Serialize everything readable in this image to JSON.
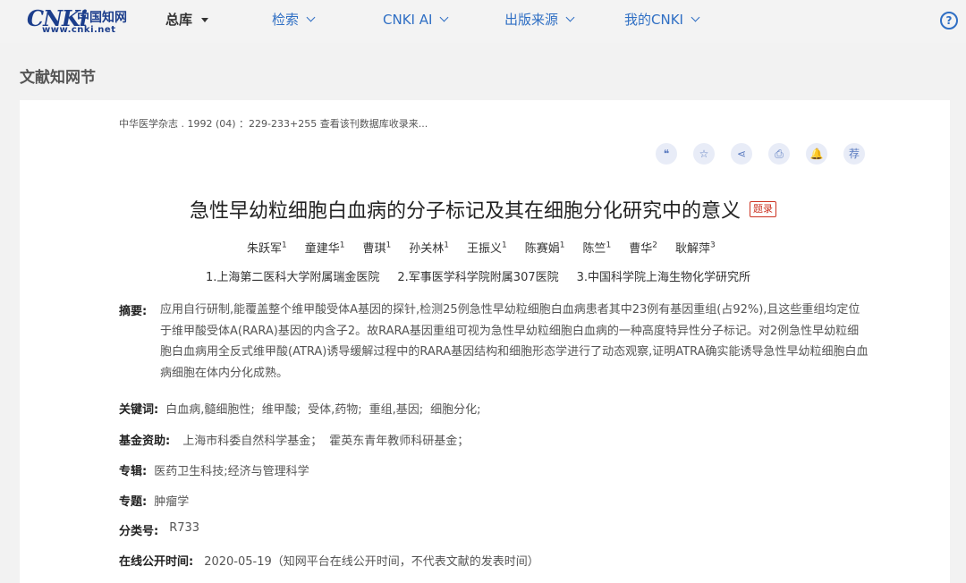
{
  "nav": {
    "logo_text": "CNKi",
    "logo_cn": "中国知网",
    "logo_url": "www.cnki.net",
    "items": [
      {
        "label": "总库"
      },
      {
        "label": "检索"
      },
      {
        "label": "CNKI AI"
      },
      {
        "label": "出版来源"
      },
      {
        "label": "我的CNKI"
      }
    ],
    "help_label": "?"
  },
  "section_title": "文献知网节",
  "source_line": "中华医学杂志 . 1992 (04) ：229-233+255  查看该刊数据库收录来...",
  "tools": [
    {
      "icon": "quote-icon",
      "glyph": "❝"
    },
    {
      "icon": "star-icon",
      "glyph": "☆"
    },
    {
      "icon": "share-icon",
      "glyph": "⋖"
    },
    {
      "icon": "print-icon",
      "glyph": "⎙"
    },
    {
      "icon": "bell-icon",
      "glyph": "🔔"
    },
    {
      "icon": "recommend-icon",
      "glyph": "荐"
    }
  ],
  "title": "急性早幼粒细胞白血病的分子标记及其在细胞分化研究中的意义",
  "title_tag": "题录",
  "authors": [
    {
      "name": "朱跃军",
      "sup": "1"
    },
    {
      "name": "童建华",
      "sup": "1"
    },
    {
      "name": "曹琪",
      "sup": "1"
    },
    {
      "name": "孙关林",
      "sup": "1"
    },
    {
      "name": "王振义",
      "sup": "1"
    },
    {
      "name": "陈赛娟",
      "sup": "1"
    },
    {
      "name": "陈竺",
      "sup": "1"
    },
    {
      "name": "曹华",
      "sup": "2"
    },
    {
      "name": "耿解萍",
      "sup": "3"
    }
  ],
  "affiliations": [
    "1.上海第二医科大学附属瑞金医院",
    "2.军事医学科学院附属307医院",
    "3.中国科学院上海生物化学研究所"
  ],
  "abstract_label": "摘要:",
  "abstract": "应用自行研制,能覆盖整个维甲酸受体A基因的探针,检测25例急性早幼粒细胞白血病患者其中23例有基因重组(占92%),且这些重组均定位于维甲酸受体A(RARA)基因的内含子2。故RARA基因重组可视为急性早幼粒细胞白血病的一种高度特异性分子标记。对2例急性早幼粒细胞白血病用全反式维甲酸(ATRA)诱导缓解过程中的RARA基因结构和细胞形态学进行了动态观察,证明ATRA确实能诱导急性早幼粒细胞白血病细胞在体内分化成熟。",
  "keywords_label": "关键词:",
  "keywords": [
    "白血病,髓细胞性;",
    "维甲酸;",
    "受体,药物;",
    "重组,基因;",
    "细胞分化;"
  ],
  "funding_label": "基金资助:",
  "funding": [
    "上海市科委自然科学基金；",
    "霍英东青年教师科研基金；"
  ],
  "album_label": "专辑:",
  "album": "医药卫生科技;经济与管理科学",
  "topic_label": "专题:",
  "topic": "肿瘤学",
  "class_label": "分类号:",
  "class_no": "R733",
  "online_label": "在线公开时间:",
  "online_time": "2020-05-19（知网平台在线公开时间，不代表文献的发表时间）",
  "colors": {
    "link": "#2f6fc4",
    "brand": "#1c3e8c",
    "tag": "#cc3322"
  }
}
